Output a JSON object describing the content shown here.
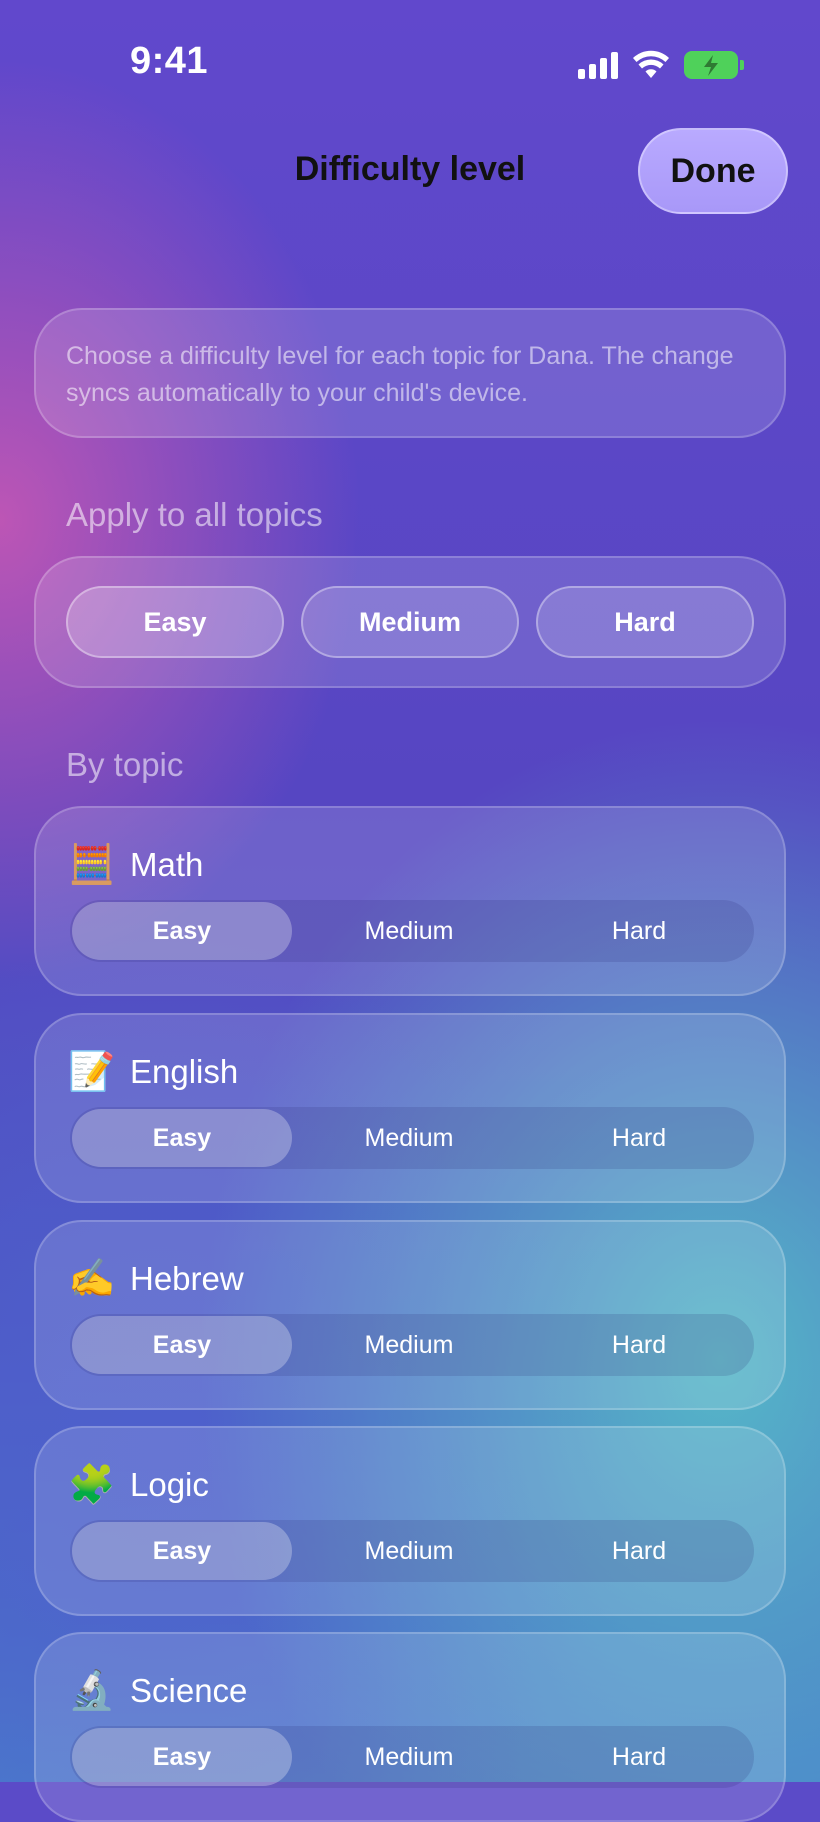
{
  "status": {
    "time": "9:41"
  },
  "nav": {
    "title": "Difficulty level",
    "done_label": "Done"
  },
  "info": {
    "text": "Choose a difficulty level for each topic for Dana. The change syncs automatically to your child's device."
  },
  "apply_all": {
    "label": "Apply to all topics",
    "options": [
      "Easy",
      "Medium",
      "Hard"
    ]
  },
  "by_topic": {
    "label": "By topic",
    "topics": [
      {
        "emoji": "🧮",
        "name": "Math",
        "options": [
          "Easy",
          "Medium",
          "Hard"
        ],
        "selected": "Easy"
      },
      {
        "emoji": "📝",
        "name": "English",
        "options": [
          "Easy",
          "Medium",
          "Hard"
        ],
        "selected": "Easy"
      },
      {
        "emoji": "✍️",
        "name": "Hebrew",
        "options": [
          "Easy",
          "Medium",
          "Hard"
        ],
        "selected": "Easy"
      },
      {
        "emoji": "🧩",
        "name": "Logic",
        "options": [
          "Easy",
          "Medium",
          "Hard"
        ],
        "selected": "Easy"
      },
      {
        "emoji": "🔬",
        "name": "Science",
        "options": [
          "Easy",
          "Medium",
          "Hard"
        ],
        "selected": "Easy"
      }
    ]
  },
  "icons": {
    "signal": "cellular-signal-icon",
    "wifi": "wifi-icon",
    "battery": "battery-charging-icon"
  },
  "colors": {
    "accent_button": "#b3a4fe",
    "battery": "#4fd15a"
  }
}
